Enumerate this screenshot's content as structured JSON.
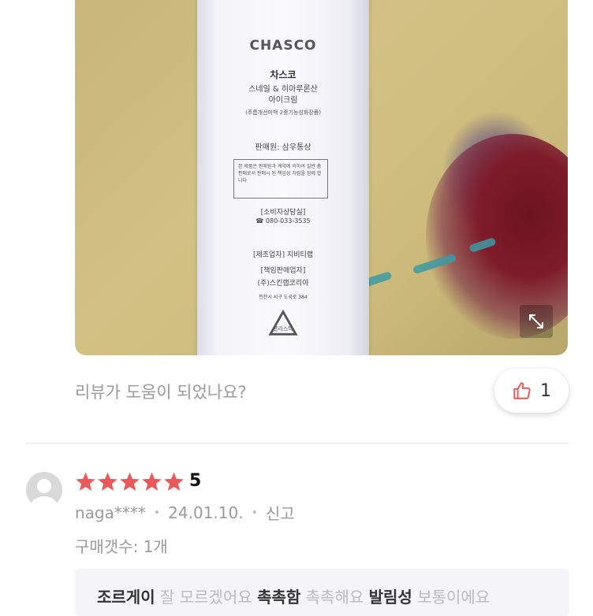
{
  "photo": {
    "tube": {
      "brand": "CHASCO",
      "name_line1": "차스코",
      "name_line2": "스네일 & 히아루론산",
      "name_line3": "아이크림",
      "name_line4": "(주름개선미백 2중기능성화장품)",
      "seller": "판매원: 삼우통상",
      "notice": "본 제품은 판매원과 계약에 의하여 일반 총 판매로서 판매시 된 책임성 처럼을 함께 합니다",
      "consult_label": "[소비자상담실]",
      "phone": "☎ 080-033-3535",
      "maker": "[제조업자] 지비티랩",
      "responsible": "[책임판매업자]",
      "corp": "(주)스킨랩코리아",
      "address": "인천시 서구 도곡로 384",
      "recycle_label": "플라스틱"
    },
    "expand_icon": "expand-icon"
  },
  "helpful": {
    "question": "리뷰가 도움이 되었나요?",
    "like_count": "1",
    "like_icon": "thumbs-up-icon"
  },
  "review": {
    "rating": 5,
    "rating_text": "5",
    "star_color": "#e85a5a",
    "user": "naga****",
    "date": "24.01.10.",
    "report": "신고",
    "qty_label": "구매갯수:",
    "qty_value": "1개",
    "tags": [
      {
        "label": "조르게이",
        "value": "잘 모르겠어요"
      },
      {
        "label": "촉촉함",
        "value": "촉촉해요"
      },
      {
        "label": "발림성",
        "value": "보통이에요"
      }
    ]
  }
}
